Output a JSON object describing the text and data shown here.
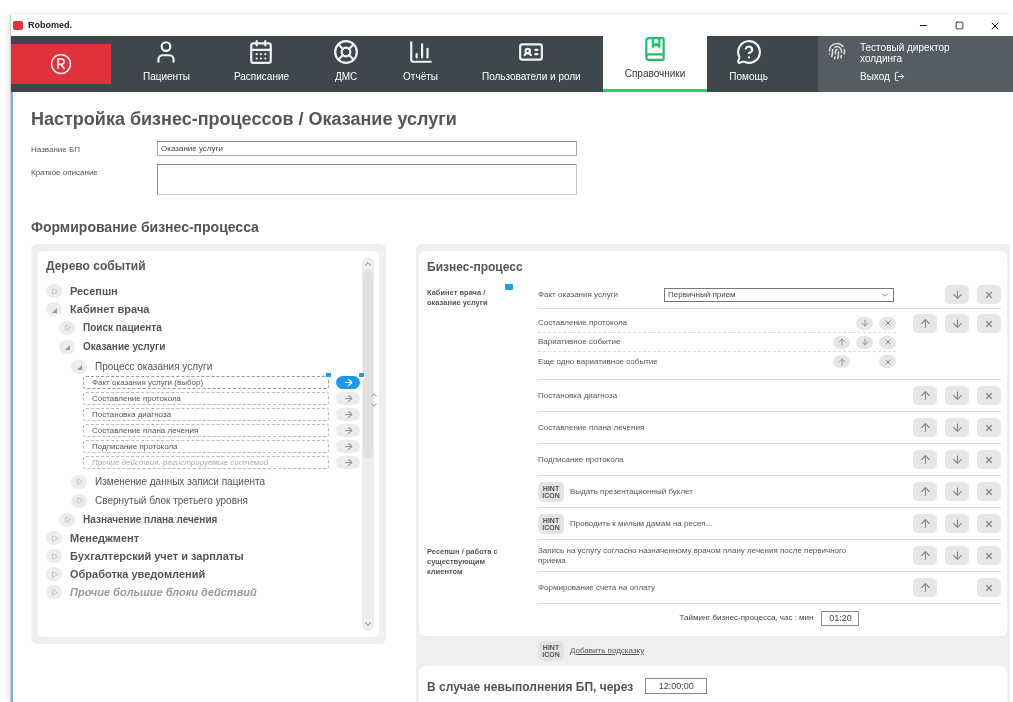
{
  "window": {
    "title": "Robomed."
  },
  "nav": {
    "items": [
      {
        "label": "Пациенты",
        "kind": "patient",
        "selected": false
      },
      {
        "label": "Расписание",
        "kind": "calendar",
        "selected": false
      },
      {
        "label": "ДМС",
        "kind": "lifebuoy",
        "selected": false
      },
      {
        "label": "Отчёты",
        "kind": "chart",
        "selected": false
      },
      {
        "label": "Пользователи и роли",
        "kind": "badge",
        "selected": false
      },
      {
        "label": "Справочники",
        "kind": "book",
        "selected": true
      },
      {
        "label": "Помощь",
        "kind": "help",
        "selected": false
      }
    ]
  },
  "user": {
    "name": "Тестовый директор холдинга",
    "logout": "Выход"
  },
  "page": {
    "title": "Настройка бизнес-процессов / Оказание услуги",
    "fields": [
      {
        "label": "Название БП",
        "kind": "line",
        "value": "Оказание услуги"
      },
      {
        "label": "Краткое описание",
        "kind": "area"
      }
    ],
    "section_title": "Формирование бизнес-процесса"
  },
  "tree": {
    "title": "Дерево событий",
    "items": [
      {
        "kind": "node",
        "label": "Ресепшн",
        "expanded": false
      },
      {
        "kind": "node",
        "label": "Кабинет врача",
        "expanded": true,
        "children": [
          {
            "kind": "node",
            "label": "Поиск пациента",
            "expanded": false
          },
          {
            "kind": "node",
            "label": "Оказание услуги",
            "expanded": true,
            "children": [
              {
                "kind": "node",
                "label": "Процесс оказания услуги",
                "expanded": true,
                "children": [
                  {
                    "kind": "step",
                    "value": "Факт оказания услуги (выбор)",
                    "selected": true
                  },
                  {
                    "kind": "step",
                    "value": "Составление протокола",
                    "selected": false
                  },
                  {
                    "kind": "step",
                    "value": "Постановка диагноза",
                    "selected": false
                  },
                  {
                    "kind": "step",
                    "value": "Составление плана лечения",
                    "selected": false
                  },
                  {
                    "kind": "step",
                    "value": "Подписание протокола",
                    "selected": false
                  },
                  {
                    "kind": "step",
                    "placeholder": "Прочие действия, регистрируемые системой",
                    "selected": false
                  }
                ]
              },
              {
                "kind": "node",
                "label": "Изменение данных записи пациента",
                "expanded": false
              },
              {
                "kind": "node",
                "label": "Свернутый блок третьего уровня",
                "expanded": false
              }
            ]
          },
          {
            "kind": "node",
            "label": "Назначение плана лечения",
            "expanded": false
          }
        ]
      },
      {
        "kind": "node",
        "label": "Менеджмент",
        "expanded": false
      },
      {
        "kind": "node",
        "label": "Бухгалтерский учет и зарплаты",
        "expanded": false
      },
      {
        "kind": "node",
        "label": "Обработка уведомлений",
        "expanded": false
      },
      {
        "kind": "more",
        "label": "Прочие большие блоки действий",
        "expanded": false
      }
    ]
  },
  "business_process": {
    "title": "Бизнес-процесс",
    "groups": [
      {
        "label": "Кабинет врача / оказание услуги",
        "note": true,
        "rows": [
          {
            "kind": "select",
            "label": "Факт оказания услуги",
            "value": "Первичный прием",
            "up": false,
            "down": true
          },
          {
            "kind": "variants",
            "up": true,
            "down": true,
            "items": [
              {
                "label": "Составление протокола",
                "up": false,
                "down": true
              },
              {
                "label": "Вариативное событие",
                "up": true,
                "down": true
              },
              {
                "label": "Еще одно вариативное событие",
                "up": true,
                "down": false
              }
            ]
          },
          {
            "kind": "event",
            "label": "Постановка диагноза",
            "up": true,
            "down": true
          },
          {
            "kind": "event",
            "label": "Составление плана лечения",
            "up": true,
            "down": true
          },
          {
            "kind": "event",
            "label": "Подписание протокола",
            "up": true,
            "down": true
          },
          {
            "kind": "event",
            "hint": "HINT ICON",
            "label": "Выдать презентационный буклет",
            "up": true,
            "down": true
          },
          {
            "kind": "event",
            "hint": "HINT ICON",
            "label": "Проводить к милым дамам на ресеп...",
            "up": true,
            "down": true
          }
        ]
      },
      {
        "label": "Ресепшн / работа с существующим клиентом",
        "note": false,
        "rows": [
          {
            "kind": "event",
            "label": "Запись на услугу согласно назначенному врачом плану лечения после первичного приема",
            "up": true,
            "down": true
          },
          {
            "kind": "event",
            "label": "Формирование счета на оплату",
            "up": true,
            "down": false
          }
        ]
      }
    ],
    "timing": {
      "label": "Тайминг бизнес-процесса, час : мин",
      "value": "01:20"
    },
    "add_hint": {
      "hint": "HINT ICON",
      "label": "Добавить подсказку"
    }
  },
  "failure": {
    "label": "В случае невыполнения БП, через",
    "value": "12:00:00"
  }
}
